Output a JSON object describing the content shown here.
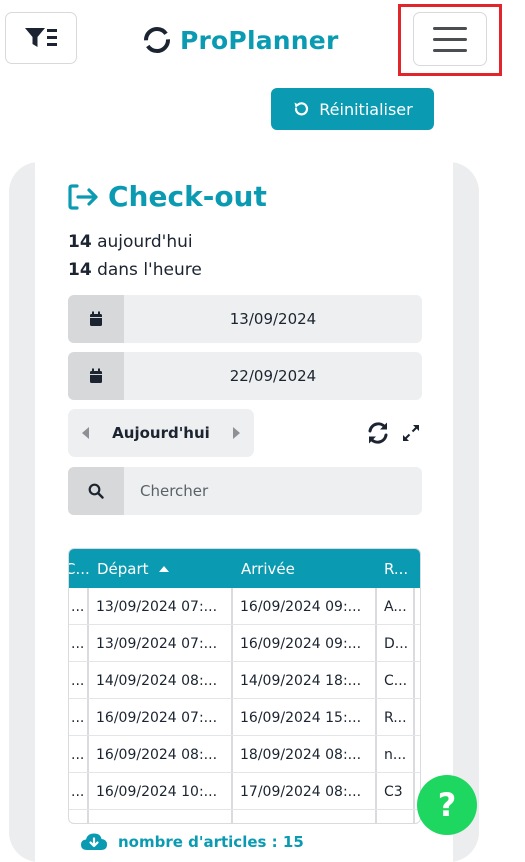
{
  "app": {
    "logo_text": "ProPlanner"
  },
  "toolbar": {
    "reset_label": "Réinitialiser"
  },
  "page": {
    "title": "Check-out",
    "stats": [
      {
        "count": "14",
        "label": "aujourd'hui"
      },
      {
        "count": "14",
        "label": "dans l'heure"
      }
    ]
  },
  "filters": {
    "date_from": "13/09/2024",
    "date_to": "22/09/2024",
    "period_label": "Aujourd'hui",
    "search_placeholder": "Chercher"
  },
  "grid": {
    "columns": [
      "C...",
      "Départ",
      "Arrivée",
      "R..."
    ],
    "rows": [
      [
        "...",
        "13/09/2024 07:...",
        "16/09/2024 09:...",
        "A..."
      ],
      [
        "...",
        "13/09/2024 07:...",
        "16/09/2024 09:...",
        "D..."
      ],
      [
        "...",
        "14/09/2024 08:...",
        "14/09/2024 18:...",
        "C..."
      ],
      [
        "...",
        "16/09/2024 07:...",
        "16/09/2024 15:...",
        "R..."
      ],
      [
        "...",
        "16/09/2024 08:...",
        "18/09/2024 08:...",
        "n..."
      ],
      [
        "...",
        "16/09/2024 10:...",
        "17/09/2024 08:...",
        "C3"
      ]
    ]
  },
  "footer": {
    "count_text": "nombre d'articles : 15"
  },
  "help": {
    "label": "?"
  },
  "colors": {
    "accent": "#0a9bb3",
    "help": "#1ed760",
    "highlight": "#e0262b"
  }
}
